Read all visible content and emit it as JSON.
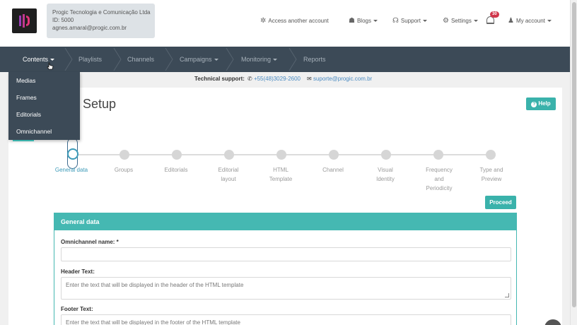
{
  "account": {
    "company": "Progic Tecnologia e Comunicação Ltda",
    "id": "ID: 5000",
    "email": "agnes.amaral@progic.com.br"
  },
  "topnav": {
    "access_another": "Access another account",
    "blogs": "Blogs",
    "support": "Support",
    "settings": "Settings",
    "notifications": "30",
    "my_account": "My account"
  },
  "mainnav": {
    "contents": "Contents",
    "playlists": "Playlists",
    "channels": "Channels",
    "campaigns": "Campaigns",
    "monitoring": "Monitoring",
    "reports": "Reports"
  },
  "dropdown": {
    "items": [
      "Medias",
      "Frames",
      "Editorials",
      "Omnichannel"
    ]
  },
  "support": {
    "label": "Technical support:",
    "phone": "+55(48)3029-2600",
    "email": "suporte@progic.com.br"
  },
  "page": {
    "title_visible": "el Setup",
    "help": "Help",
    "proceed": "Proceed"
  },
  "steps": {
    "general": "General data",
    "groups": "Groups",
    "editorials": "Editorials",
    "editorial_1": "Editorial",
    "editorial_2": "layout",
    "html_1": "HTML",
    "html_2": "Template",
    "channel": "Channel",
    "visual_1": "Visual",
    "visual_2": "Identity",
    "freq_1": "Frequency",
    "freq_2": "and",
    "freq_3": "Periodicity",
    "type_1": "Type and",
    "type_2": "Preview"
  },
  "form": {
    "panel_title": "General data",
    "name_label": "Omnichannel name: *",
    "name_value": "",
    "header_label": "Header Text:",
    "header_placeholder": "Enter the text that will be displayed in the header of the HTML template",
    "footer_label": "Footer Text:",
    "footer_placeholder": "Enter the text that will be displayed in the footer of the HTML template"
  },
  "colors": {
    "nav_bg": "#3c4a57",
    "accent": "#45b8b2",
    "badge": "#d0364b"
  }
}
